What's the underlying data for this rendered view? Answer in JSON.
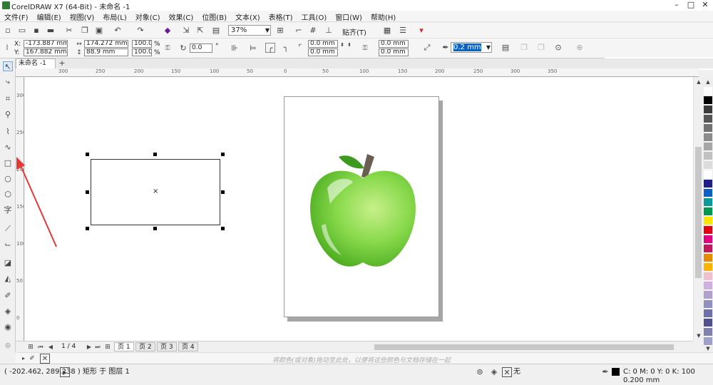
{
  "window": {
    "title": "CorelDRAW X7 (64-Bit) - 未命名 -1",
    "min": "–",
    "max": "□",
    "close": "✕"
  },
  "menu": [
    "文件(F)",
    "编辑(E)",
    "视图(V)",
    "布局(L)",
    "对象(C)",
    "效果(C)",
    "位图(B)",
    "文本(X)",
    "表格(T)",
    "工具(O)",
    "窗口(W)",
    "帮助(H)"
  ],
  "standard_toolbar": {
    "zoom": "37%",
    "snap": "贴齐(T)"
  },
  "property_bar": {
    "x": "-173.887 mm",
    "y": "167.882 mm",
    "x_label": "X:",
    "y_label": "Y:",
    "width": "174.272 mm",
    "height": "88.9 mm",
    "scale_w": "100.0",
    "scale_h": "100.0",
    "pct": "%",
    "rotation": "0.0",
    "deg": "°",
    "corner1": "0.0 mm",
    "corner2": "0.0 mm",
    "corner3": "0.0 mm",
    "corner4": "0.0 mm",
    "outline_width": "0.2 mm"
  },
  "doc_tab": "未命名 -1",
  "rulers": {
    "h_ticks": [
      "300",
      "250",
      "200",
      "150",
      "100",
      "50",
      "0",
      "50",
      "100",
      "150",
      "200",
      "250",
      "300",
      "350"
    ],
    "v_ticks": [
      "300",
      "250",
      "200",
      "150",
      "100",
      "50",
      "0",
      "50"
    ]
  },
  "page_nav": {
    "counter": "1 / 4",
    "pages": [
      "页 1",
      "页 2",
      "页 3",
      "页 4"
    ]
  },
  "doc_palette_hint": "将颜色(或对象)拖动至此处，以便将这些颜色与文档存储在一起",
  "status": {
    "coords": "( -202.462, 289.238 )",
    "object": "矩形 于 图层 1",
    "fill": "无",
    "outline": "C: 0 M: 0 Y: 0 K: 100  0.200 mm"
  },
  "sogou": {
    "logo": "S",
    "mode": "中"
  },
  "palette": [
    "#ffffff",
    "#000000",
    "#3b3b3b",
    "#565656",
    "#727272",
    "#8c8c8c",
    "#a6a6a6",
    "#c1c1c1",
    "#dcdcdc",
    "#ffffff",
    "#1f1f8a",
    "#0c5ec9",
    "#0a9a9a",
    "#00994d",
    "#ffe600",
    "#e60012",
    "#e6007e",
    "#c2185b",
    "#e68a00",
    "#ffb300",
    "#f0c0d0",
    "#d0b0e0",
    "#b0a0d0",
    "#9090c0",
    "#7070a8",
    "#505090",
    "#8080b0",
    "#a0a0c8"
  ]
}
